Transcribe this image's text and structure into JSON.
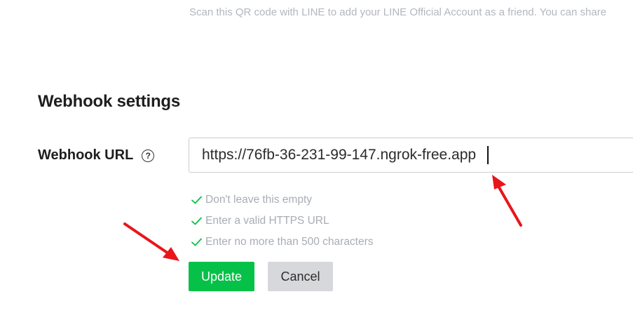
{
  "qr_hint": "Scan this QR code with LINE to add your LINE Official Account as a friend. You can share",
  "webhook": {
    "section_title": "Webhook settings",
    "url_label": "Webhook URL",
    "help_glyph": "?",
    "url_value": "https://76fb-36-231-99-147.ngrok-free.app",
    "validation": [
      "Don't leave this empty",
      "Enter a valid HTTPS URL",
      "Enter no more than 500 characters"
    ],
    "update_label": "Update",
    "cancel_label": "Cancel"
  },
  "colors": {
    "accent_green": "#06c148",
    "check_green": "#06c148",
    "annotation_red": "#e8161a"
  },
  "icons": [
    "help-icon",
    "check-icon",
    "red-arrow-annotation"
  ]
}
